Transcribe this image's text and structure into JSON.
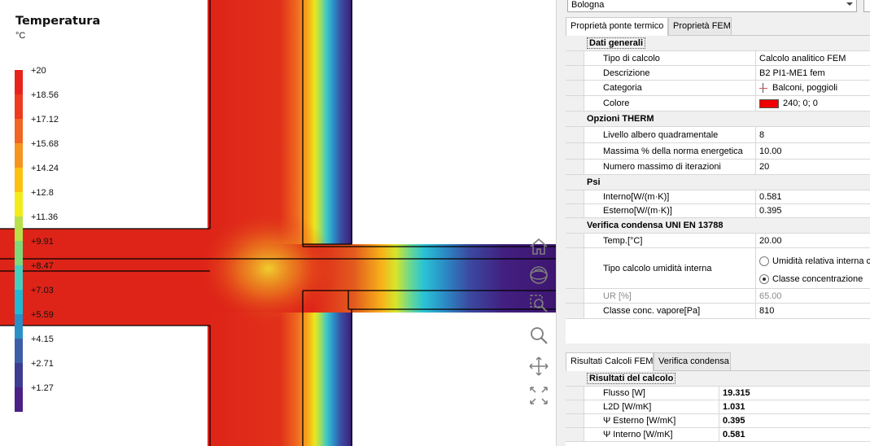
{
  "legend": {
    "title": "Temperatura",
    "unit": "°C",
    "labels": [
      "+20",
      "+18.56",
      "+17.12",
      "+15.68",
      "+14.24",
      "+12.8",
      "+11.36",
      "+9.91",
      "+8.47",
      "+7.03",
      "+5.59",
      "+4.15",
      "+2.71",
      "+1.27"
    ],
    "colors": [
      "#e8231c",
      "#ee3a1e",
      "#f26522",
      "#f7941d",
      "#fcc10f",
      "#f4ec1a",
      "#b8e04a",
      "#7fd87a",
      "#45cfc1",
      "#1fb9d6",
      "#2b8fc7",
      "#3c5ea8",
      "#3e3b92",
      "#4b1f86"
    ]
  },
  "nav_icons": [
    "home-icon",
    "orbit-icon",
    "zoom-extents-icon",
    "zoom-icon",
    "pan-icon",
    "fit-icon"
  ],
  "location": {
    "value": "Bologna"
  },
  "top_tabs": [
    {
      "label": "Proprietà ponte termico",
      "active": true
    },
    {
      "label": "Proprietà FEM",
      "active": false
    }
  ],
  "props": {
    "general": {
      "title": "Dati generali",
      "rows": [
        {
          "name": "Tipo di calcolo",
          "value": "Calcolo analitico FEM"
        },
        {
          "name": "Descrizione",
          "value": "B2 PI1-ME1 fem"
        },
        {
          "name": "Categoria",
          "value": "Balconi, poggioli"
        },
        {
          "name": "Colore",
          "value": "240; 0; 0"
        }
      ]
    },
    "therm": {
      "title": "Opzioni THERM",
      "rows": [
        {
          "name": "Livello albero quadramentale",
          "value": "8"
        },
        {
          "name": "Massima % della norma energetica",
          "value": "10.00"
        },
        {
          "name": "Numero massimo di iterazioni",
          "value": "20"
        }
      ]
    },
    "psi": {
      "title": "Psi",
      "rows": [
        {
          "name": "Interno[W/(m·K)]",
          "value": "0.581"
        },
        {
          "name": "Esterno[W/(m·K)]",
          "value": "0.395"
        }
      ]
    },
    "condensa": {
      "title": "Verifica condensa  UNI EN 13788",
      "temp": {
        "name": "Temp.[°C]",
        "value": "20.00"
      },
      "humidity": {
        "name": "Tipo calcolo umidità interna",
        "option1": "Umidità relativa interna c",
        "option2": "Classe concentrazione"
      },
      "ur": {
        "name": "UR [%]",
        "value": "65.00"
      },
      "vapor": {
        "name": "Classe conc. vapore[Pa]",
        "value": "810"
      }
    }
  },
  "bottom_tabs": [
    {
      "label": "Risultati Calcoli FEM",
      "active": true
    },
    {
      "label": "Verifica condensa",
      "active": false
    }
  ],
  "results": {
    "title": "Risultati del calcolo",
    "rows": [
      {
        "name": "Flusso [W]",
        "value": "19.315"
      },
      {
        "name": "L2D [W/mK]",
        "value": "1.031"
      },
      {
        "name": "Ψ Esterno [W/mK]",
        "value": "0.395"
      },
      {
        "name": "Ψ Interno [W/mK]",
        "value": "0.581"
      }
    ]
  }
}
